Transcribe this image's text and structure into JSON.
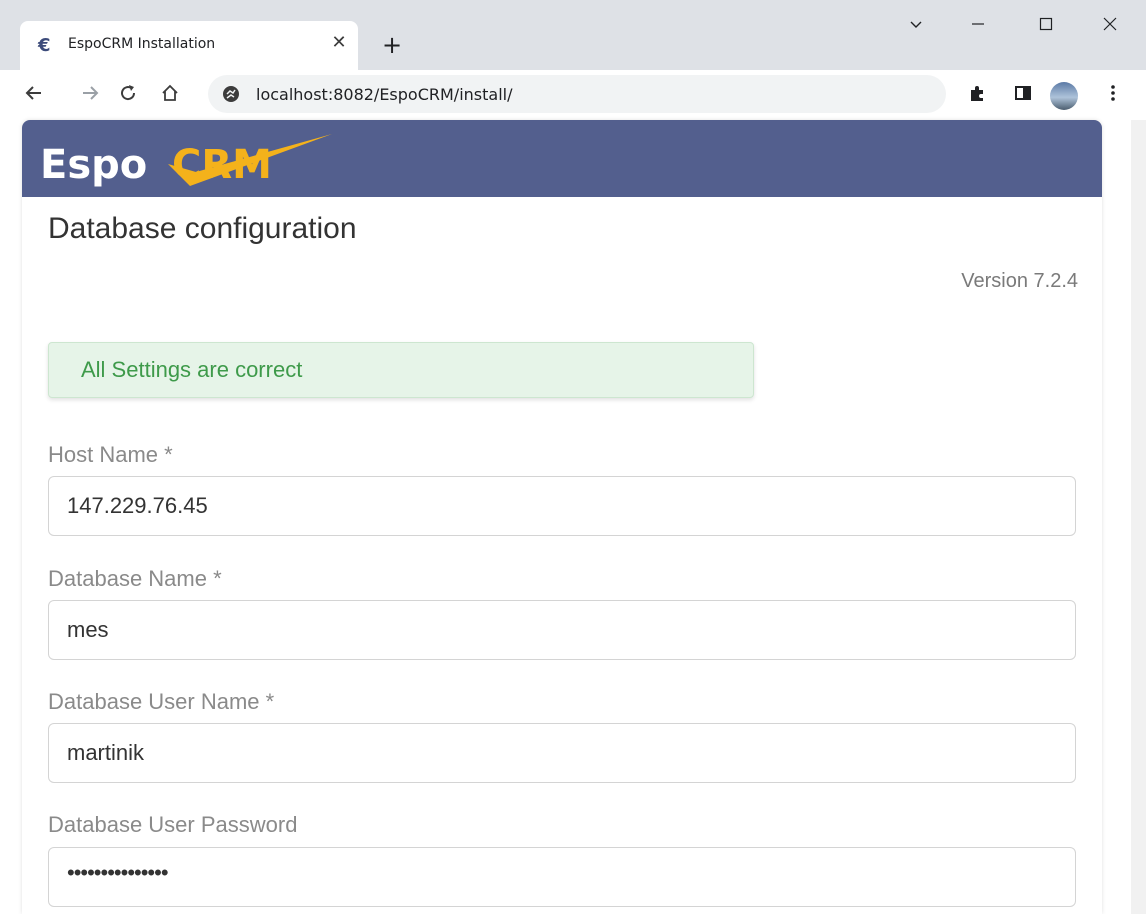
{
  "browser": {
    "tab_title": "EspoCRM Installation",
    "tab_favicon": "€",
    "url": "localhost:8082/EspoCRM/install/",
    "icons": [
      "back-arrow-icon",
      "forward-arrow-icon",
      "reload-icon",
      "home-icon",
      "site-info-icon",
      "extensions-icon",
      "side-panel-icon",
      "profile-avatar",
      "more-menu-icon",
      "tab-search-icon",
      "minimize-icon",
      "maximize-icon",
      "close-window-icon",
      "new-tab-icon",
      "tab-close-icon"
    ]
  },
  "page": {
    "logo_text_espo": "Espo",
    "logo_text_crm": "CRM",
    "title": "Database configuration",
    "version": "Version 7.2.4",
    "alert": "All Settings are correct",
    "fields": [
      {
        "label": "Host Name *",
        "value": "147.229.76.45"
      },
      {
        "label": "Database Name *",
        "value": "mes"
      },
      {
        "label": "Database User Name *",
        "value": "martinik"
      },
      {
        "label": "Database User Password",
        "value": "•••••••••••••••"
      }
    ]
  },
  "colors": {
    "header_bg": "#535f8e",
    "logo_accent": "#f4b21b",
    "alert_bg": "#e6f4e8",
    "alert_text": "#3e9a4a"
  }
}
